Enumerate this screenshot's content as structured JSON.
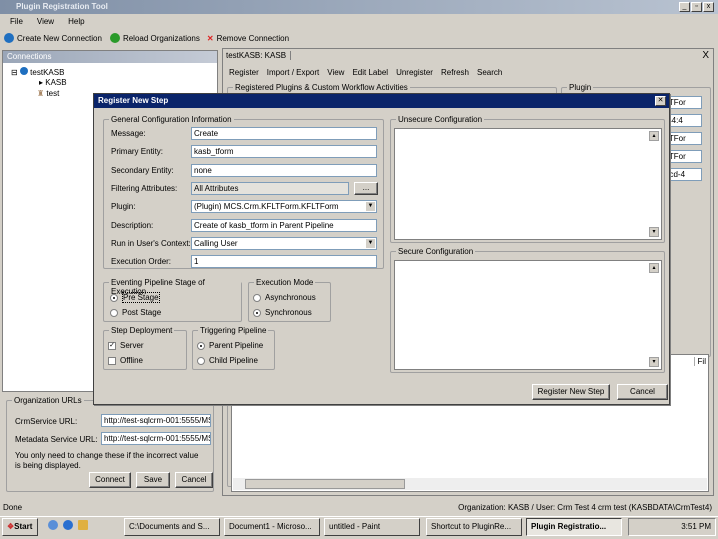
{
  "window": {
    "title": "Plugin Registration Tool"
  },
  "menu": [
    "File",
    "View",
    "Help"
  ],
  "toolbar": {
    "create": "Create New Connection",
    "reload": "Reload Organizations",
    "remove": "Remove Connection"
  },
  "connections": {
    "header": "Connections",
    "tree": [
      "testKASB",
      "KASB",
      "test"
    ]
  },
  "org_urls": {
    "legend": "Organization URLs",
    "crm_label": "CrmService URL:",
    "crm_value": "http://test-sqlcrm-001:5555/MS",
    "meta_label": "Metadata Service URL:",
    "meta_value": "http://test-sqlcrm-001:5555/MS",
    "note": "You only need to change these if the incorrect value is being displayed.",
    "connect": "Connect",
    "save": "Save",
    "cancel": "Cancel"
  },
  "right": {
    "tab": "testKASB: KASB",
    "close": "X",
    "toolbar": [
      "Register",
      "Import / Export",
      "View",
      "Edit Label",
      "Unregister",
      "Refresh",
      "Search"
    ],
    "registered_legend": "Registered Plugins & Custom Workflow Activities",
    "plugin_legend": "Plugin",
    "plugin_fields": [
      "LTFor",
      ":44:4",
      "LTFor",
      "LTFor",
      "0cd-4"
    ],
    "col": "Fil"
  },
  "dialog": {
    "title": "Register New Step",
    "general_legend": "General Configuration Information",
    "fields": [
      {
        "label": "Message:",
        "value": "Create"
      },
      {
        "label": "Primary Entity:",
        "value": "kasb_tform"
      },
      {
        "label": "Secondary Entity:",
        "value": "none"
      },
      {
        "label": "Filtering Attributes:",
        "value": "All Attributes"
      },
      {
        "label": "Plugin:",
        "value": "(Plugin) MCS.Crm.KFLTForm.KFLTForm"
      },
      {
        "label": "Description:",
        "value": "Create of kasb_tform in Parent Pipeline"
      },
      {
        "label": "Run in User's Context:",
        "value": "Calling User"
      },
      {
        "label": "Execution Order:",
        "value": "1"
      }
    ],
    "browse": "...",
    "stage_legend": "Eventing Pipeline Stage of Execution",
    "pre": "Pre Stage",
    "post": "Post Stage",
    "mode_legend": "Execution Mode",
    "async": "Asynchronous",
    "sync": "Synchronous",
    "deploy_legend": "Step Deployment",
    "server": "Server",
    "offline": "Offline",
    "trigger_legend": "Triggering Pipeline",
    "parent": "Parent Pipeline",
    "child": "Child Pipeline",
    "unsecure_legend": "Unsecure Configuration",
    "secure_legend": "Secure Configuration",
    "register": "Register New Step",
    "cancel": "Cancel"
  },
  "status": {
    "left": "Done",
    "right": "Organization: KASB / User: Crm Test 4 crm test (KASBDATA\\CrmTest4)"
  },
  "taskbar": {
    "start": "Start",
    "tasks": [
      "C:\\Documents and S...",
      "Document1 - Microso...",
      "untitled - Paint",
      "Shortcut to PluginRe...",
      "Plugin Registratio..."
    ],
    "clock": "3:51 PM"
  }
}
